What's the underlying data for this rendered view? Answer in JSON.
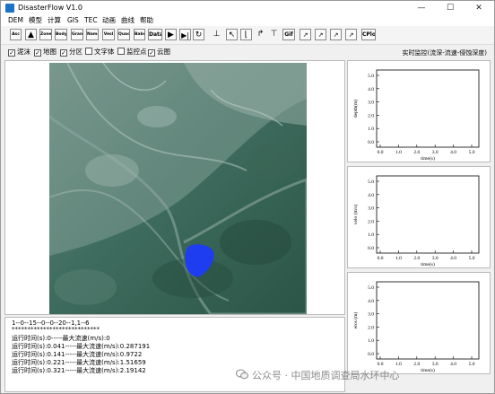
{
  "app": {
    "title": "DisasterFlow V1.0"
  },
  "window_controls": {
    "minimize": "—",
    "maximize": "☐",
    "close": "✕"
  },
  "menu": [
    "DEM",
    "模型",
    "计算",
    "GIS",
    "TEC",
    "动画",
    "曲线",
    "帮助"
  ],
  "toolbar": {
    "buttons": [
      "Asc",
      "Zone",
      "Body",
      "Grane",
      "Name",
      "Vesl",
      "Quad",
      "Babs",
      "Data",
      "Gif",
      "CPlot"
    ],
    "icons": [
      "up-arrow-icon",
      "play-icon",
      "step-icon",
      "refresh-icon",
      "measure-icon",
      "corner-tl-icon",
      "corner-bl-icon",
      "corner-up-icon",
      "corner-t-icon",
      "curve-plot-icon"
    ]
  },
  "layers": [
    {
      "label": "泥沫",
      "checked": true
    },
    {
      "label": "地图",
      "checked": true
    },
    {
      "label": "分区",
      "checked": true
    },
    {
      "label": "文字体",
      "checked": false
    },
    {
      "label": "监控点",
      "checked": false
    },
    {
      "label": "云图",
      "checked": true
    }
  ],
  "monitor_title": "实时监控(流深-流速-侵蚀深度)",
  "log": {
    "lines": [
      "1--0--15--0--0--20--1,1--6",
      "****************************",
      "运行时间(s):0-----最大流速(m/s):0",
      "运行时间(s):0.041-----最大流速(m/s):0.287191",
      "运行时间(s):0.141-----最大流速(m/s):0.9722",
      "运行时间(s):0.221-----最大流速(m/s):1.51659",
      "运行时间(s):0.321-----最大流速(m/s):2.19142"
    ]
  },
  "charts": [
    {
      "ylabel": "depth(m)",
      "xlabel": "time(s)",
      "yticks": [
        "0.0",
        "1.0",
        "2.0",
        "3.0",
        "4.0",
        "5.0"
      ],
      "xticks": [
        "0.0",
        "1.0",
        "2.0",
        "3.0",
        "4.0",
        "5.0"
      ]
    },
    {
      "ylabel": "velo (m/s)",
      "xlabel": "time(s)",
      "yticks": [
        "0.0",
        "1.0",
        "2.0",
        "3.0",
        "4.0",
        "5.0"
      ],
      "xticks": [
        "0.0",
        "1.0",
        "2.0",
        "3.0",
        "4.0",
        "5.0"
      ]
    },
    {
      "ylabel": "eros (m)",
      "xlabel": "time(s)",
      "yticks": [
        "0.0",
        "1.0",
        "2.0",
        "3.0",
        "4.0",
        "5.0"
      ],
      "xticks": [
        "0.0",
        "1.0",
        "2.0",
        "3.0",
        "4.0",
        "5.0"
      ]
    }
  ],
  "watermark": "公众号 · 中国地质调查局水环中心",
  "colors": {
    "flow_blob": "#1e3cf0",
    "terrain_dark": "#2f5a4c",
    "terrain_light": "#7f9c93"
  }
}
